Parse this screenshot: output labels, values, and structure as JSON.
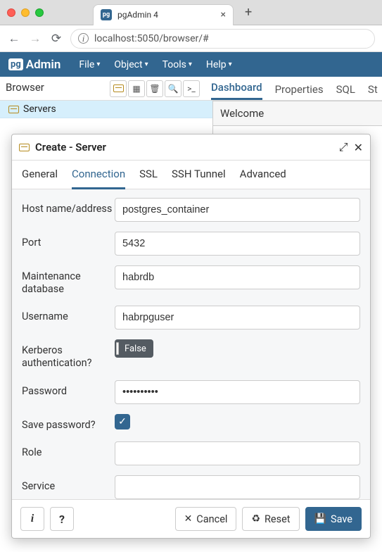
{
  "window": {
    "tab_title": "pgAdmin 4",
    "favicon_text": "pg"
  },
  "address_bar": {
    "url": "localhost:5050/browser/#"
  },
  "pgadmin": {
    "logo_box": "pg",
    "logo_text": "Admin",
    "menus": [
      "File",
      "Object",
      "Tools",
      "Help"
    ]
  },
  "browser_panel": {
    "label": "Browser",
    "tree": {
      "servers_label": "Servers"
    }
  },
  "main_tabs": [
    "Dashboard",
    "Properties",
    "SQL",
    "St"
  ],
  "main_tabs_active_index": 0,
  "right_panel": {
    "welcome": "Welcome"
  },
  "dialog": {
    "title": "Create - Server",
    "tabs": [
      "General",
      "Connection",
      "SSL",
      "SSH Tunnel",
      "Advanced"
    ],
    "active_tab_index": 1,
    "fields": {
      "host_label": "Host name/address",
      "host_value": "postgres_container",
      "port_label": "Port",
      "port_value": "5432",
      "maintdb_label": "Maintenance database",
      "maintdb_value": "habrdb",
      "username_label": "Username",
      "username_value": "habrpguser",
      "kerberos_label": "Kerberos authentication?",
      "kerberos_value": "False",
      "password_label": "Password",
      "password_value": "••••••••••",
      "savepw_label": "Save password?",
      "savepw_checked": true,
      "role_label": "Role",
      "role_value": "",
      "service_label": "Service",
      "service_value": ""
    },
    "footer": {
      "info": "i",
      "help": "?",
      "cancel": "Cancel",
      "reset": "Reset",
      "save": "Save"
    }
  }
}
